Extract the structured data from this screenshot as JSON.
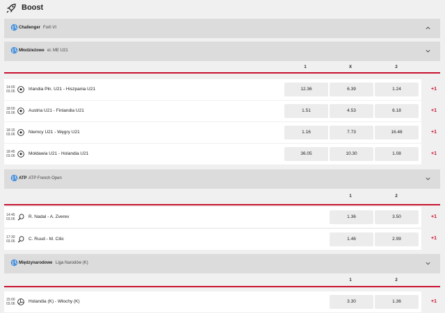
{
  "header": {
    "title": "Boost"
  },
  "columns3": {
    "c1": "1",
    "cx": "X",
    "c2": "2"
  },
  "columns2": {
    "c1": "1",
    "c2": "2"
  },
  "sections": [
    {
      "sport": "Challenger",
      "competition": "Forli VI"
    },
    {
      "sport": "Młodzieżowe",
      "competition": "el. ME U21"
    },
    {
      "sport": "ATP",
      "competition": "ATP French Open"
    },
    {
      "sport": "Międzynarodowe",
      "competition": "Liga Narodów (K)"
    }
  ],
  "matches": [
    {
      "time": "14:00",
      "date": "03.06",
      "name": "Irlandia Płn. U21 - Hiszpania U21",
      "odd1": "12.36",
      "oddx": "6.39",
      "odd2": "1.24",
      "more": "+1"
    },
    {
      "time": "18:00",
      "date": "03.06",
      "name": "Austria U21 - Finlandia U21",
      "odd1": "1.51",
      "oddx": "4.53",
      "odd2": "6.18",
      "more": "+1"
    },
    {
      "time": "18:15",
      "date": "03.06",
      "name": "Niemcy U21 - Węgry U21",
      "odd1": "1.16",
      "oddx": "7.73",
      "odd2": "16.48",
      "more": "+1"
    },
    {
      "time": "18:45",
      "date": "03.06",
      "name": "Mołdawia U21 - Holandia U21",
      "odd1": "36.05",
      "oddx": "10.30",
      "odd2": "1.08",
      "more": "+1"
    },
    {
      "time": "14:45",
      "date": "03.06",
      "name": "R. Nadal - A. Zverev",
      "odd1": "1.36",
      "odd2": "3.50",
      "more": "+1"
    },
    {
      "time": "17:30",
      "date": "03.06",
      "name": "C. Ruud - M. Cilic",
      "odd1": "1.46",
      "odd2": "2.99",
      "more": "+1"
    },
    {
      "time": "15:00",
      "date": "03.06",
      "name": "Holandia (K) - Włochy (K)",
      "odd1": "3.30",
      "odd2": "1.36",
      "more": "+1"
    }
  ],
  "icons": {
    "rocket": "rocket-icon",
    "globe": "globe-icon",
    "soccer": "soccer-ball-icon",
    "tennis": "tennis-racket-icon",
    "volley": "volleyball-icon",
    "chev_up": "chevron-up-icon",
    "chev_down": "chevron-down-icon"
  },
  "colors": {
    "accent": "#c8102e",
    "section_bg": "#dcdcdc",
    "odd_bg": "#ececec",
    "globe": "#4a90d9"
  }
}
